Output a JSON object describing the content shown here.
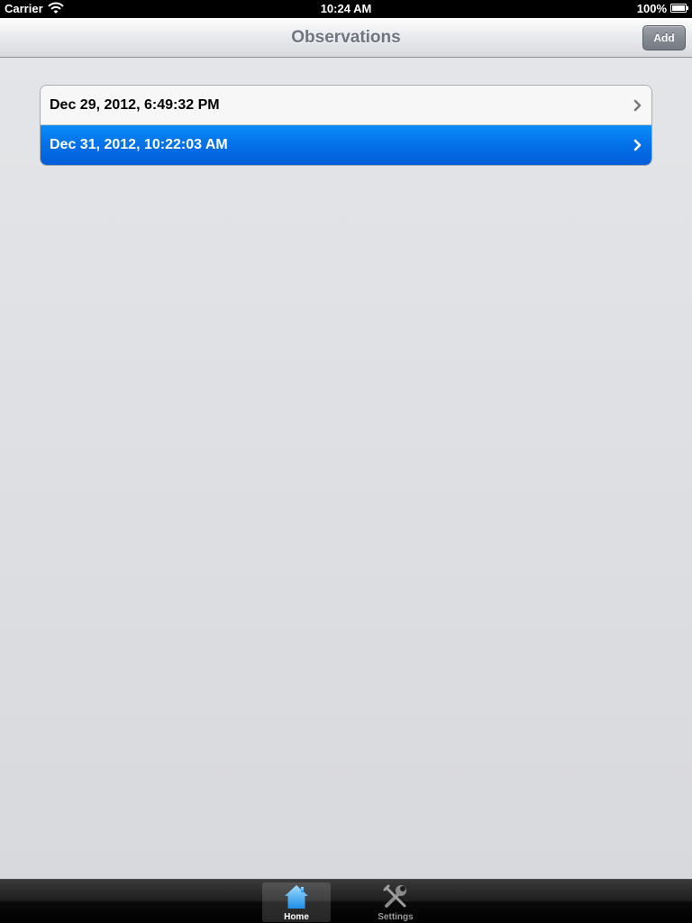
{
  "status_bar": {
    "carrier": "Carrier",
    "time": "10:24 AM",
    "battery": "100%"
  },
  "nav_bar": {
    "title": "Observations",
    "add_label": "Add"
  },
  "observations": {
    "rows": [
      {
        "label": "Dec 29, 2012, 6:49:32 PM",
        "selected": false
      },
      {
        "label": "Dec 31, 2012, 10:22:03 AM",
        "selected": true
      }
    ]
  },
  "tab_bar": {
    "tabs": [
      {
        "label": "Home",
        "icon": "home-icon",
        "active": true
      },
      {
        "label": "Settings",
        "icon": "settings-icon",
        "active": false
      }
    ]
  },
  "colors": {
    "selected_row": "#0470e8",
    "nav_title": "#6e7480",
    "background": "#dcdee2"
  }
}
